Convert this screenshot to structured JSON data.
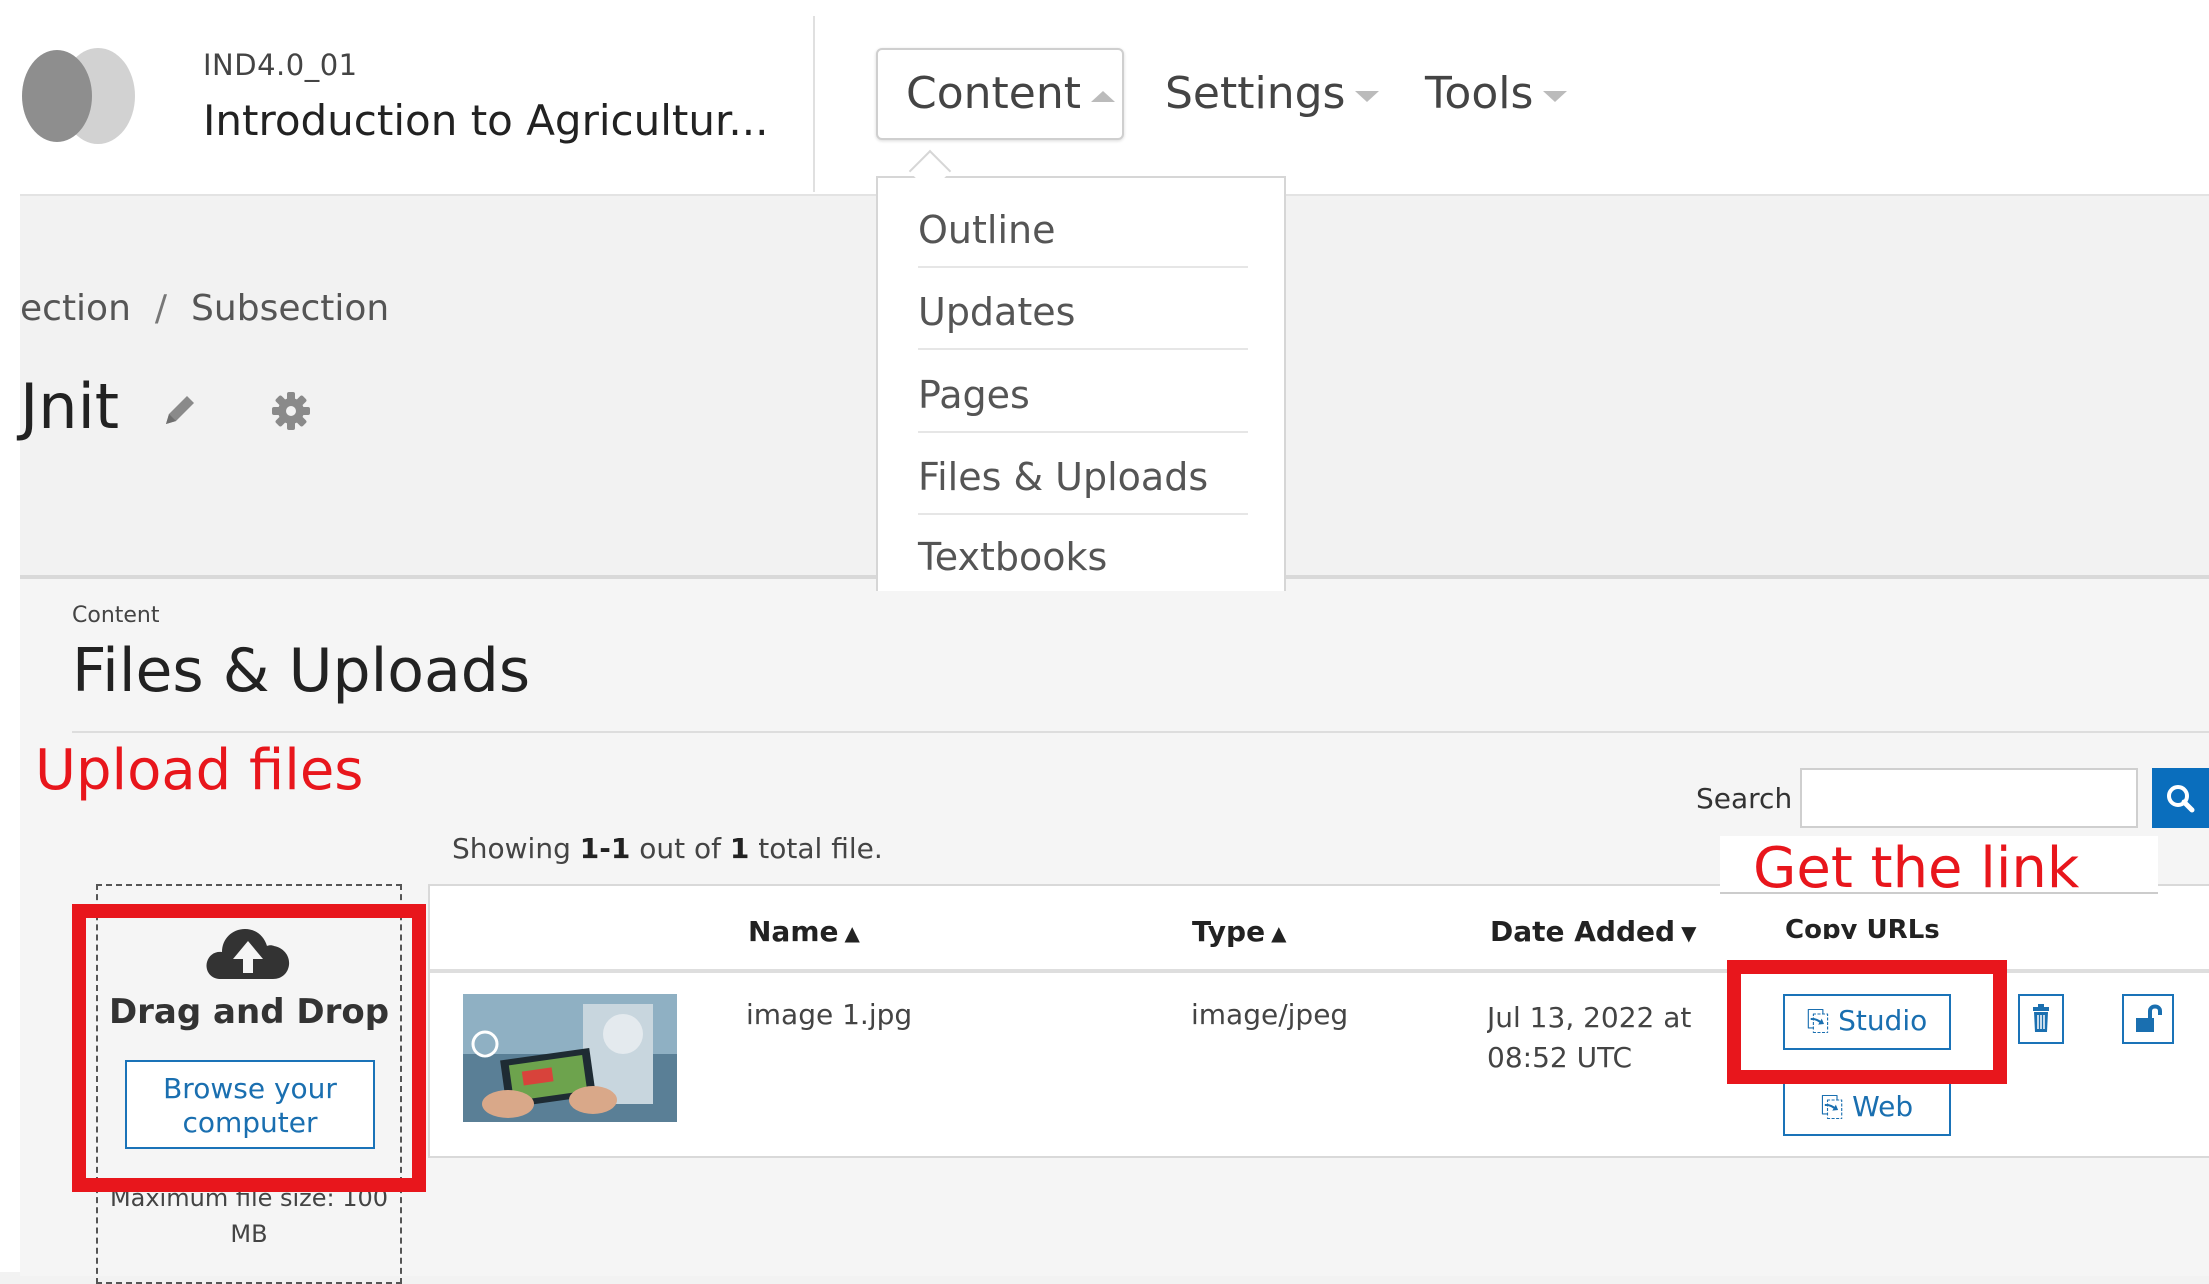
{
  "header": {
    "course_org": "IND4.0_01",
    "course_title": "Introduction to Agricultur...",
    "nav": {
      "content": "Content",
      "settings": "Settings",
      "tools": "Tools"
    },
    "content_menu": [
      "Outline",
      "Updates",
      "Pages",
      "Files & Uploads",
      "Textbooks"
    ]
  },
  "breadcrumb": {
    "section": "ection",
    "subsection": "Subsection"
  },
  "unit": {
    "title": "Jnit"
  },
  "page": {
    "section_label": "Content",
    "title": "Files & Uploads"
  },
  "annotations": {
    "upload": "Upload files",
    "link": "Get the link",
    "color": "#e8161c"
  },
  "search": {
    "label": "Search",
    "value": ""
  },
  "summary": {
    "prefix": "Showing ",
    "range": "1-1",
    "middle": " out of ",
    "total": "1",
    "suffix": " total file."
  },
  "upload": {
    "title": "Drag and Drop",
    "browse": "Browse your computer",
    "max_size": "Maximum file size: 100 MB"
  },
  "table": {
    "headers": {
      "name": "Name",
      "type": "Type",
      "date": "Date Added",
      "copy": "Copy URLs"
    },
    "rows": [
      {
        "name": "image 1.jpg",
        "type": "image/jpeg",
        "date": "Jul 13, 2022 at 08:52 UTC"
      }
    ],
    "copy_buttons": {
      "studio": "Studio",
      "web": "Web"
    }
  },
  "colors": {
    "accent": "#1a6fb0",
    "search_button": "#0a6ebd"
  }
}
